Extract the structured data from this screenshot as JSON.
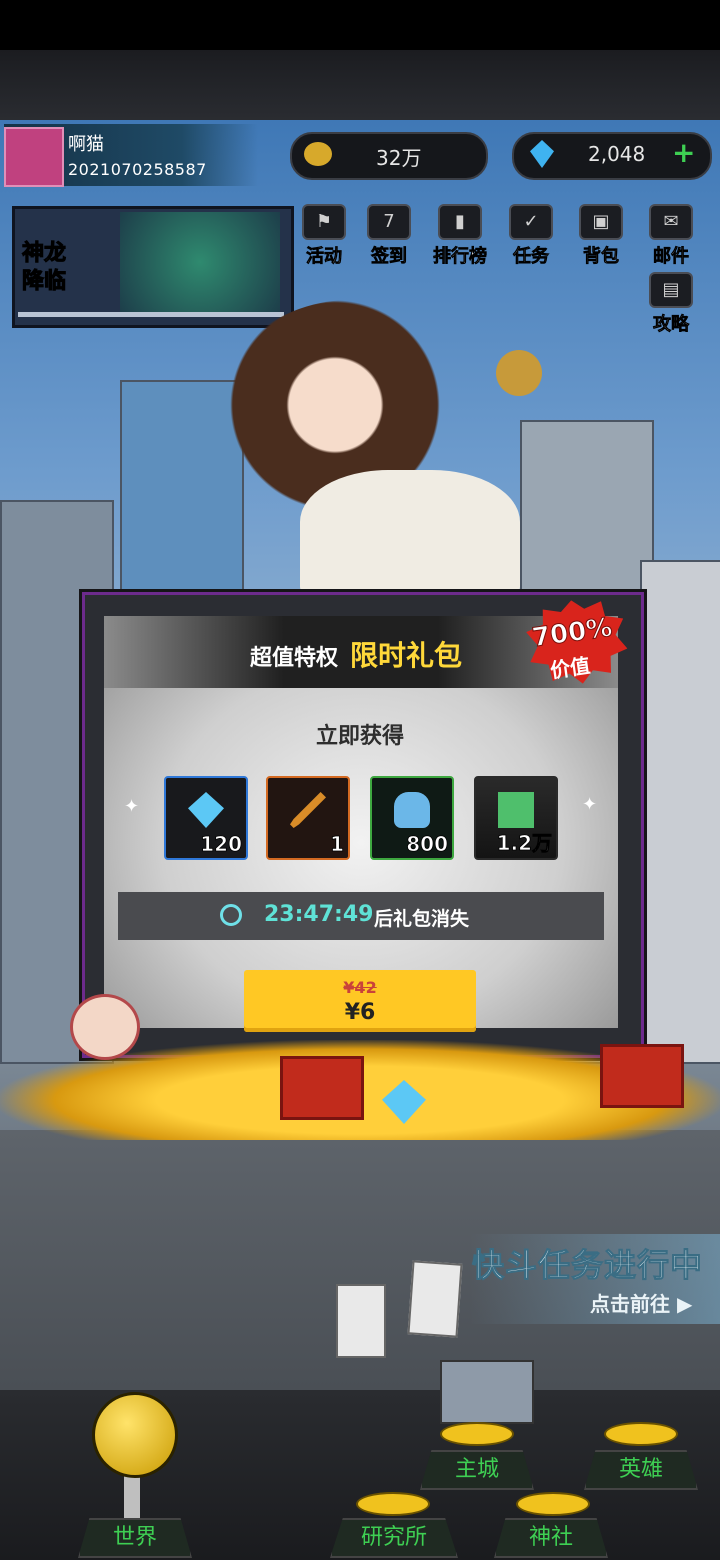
{
  "player": {
    "name": "啊猫",
    "id": "2021070258587"
  },
  "currencies": {
    "gold": "32万",
    "gems": "2,048",
    "add_symbol": "+"
  },
  "event_banner": {
    "title": "神龙\n降临"
  },
  "top_menu": [
    {
      "label": "活动",
      "icon": "event-icon",
      "glyph": "⚑"
    },
    {
      "label": "签到",
      "icon": "calendar-icon",
      "glyph": "7"
    },
    {
      "label": "排行榜",
      "icon": "ranking-icon",
      "glyph": "▮"
    },
    {
      "label": "任务",
      "icon": "task-icon",
      "glyph": "✓"
    },
    {
      "label": "背包",
      "icon": "backpack-icon",
      "glyph": "▣"
    },
    {
      "label": "邮件",
      "icon": "mail-icon",
      "glyph": "✉"
    }
  ],
  "guide": {
    "label": "攻略",
    "glyph": "▤"
  },
  "dialog": {
    "header_prefix": "超值特权",
    "header_title": "限时礼包",
    "badge_percent": "700%",
    "badge_label": "价值",
    "subtitle": "立即获得",
    "items": [
      {
        "name": "gem-item",
        "qty": "120",
        "border": "#2f78d8"
      },
      {
        "name": "sword-item",
        "qty": "1",
        "border": "#d46a22"
      },
      {
        "name": "armor-item",
        "qty": "800",
        "border": "#3ea840"
      },
      {
        "name": "cash-item",
        "qty": "1.2万",
        "border": "#2a2a2a"
      }
    ],
    "timer": "23:47:49",
    "timer_suffix": "后礼包消失",
    "price_old": "¥42",
    "price_new": "¥6"
  },
  "quest": {
    "title": "快斗任务进行中",
    "action": "点击前往 ▶"
  },
  "nav": {
    "world": "世界",
    "main_city": "主城",
    "heroes": "英雄",
    "research": "研究所",
    "shrine": "神社"
  },
  "colors": {
    "accent_yellow": "#ffc824",
    "timer_cyan": "#5fe2d6",
    "nav_green": "#3ecf53",
    "badge_red": "#d9241c"
  }
}
